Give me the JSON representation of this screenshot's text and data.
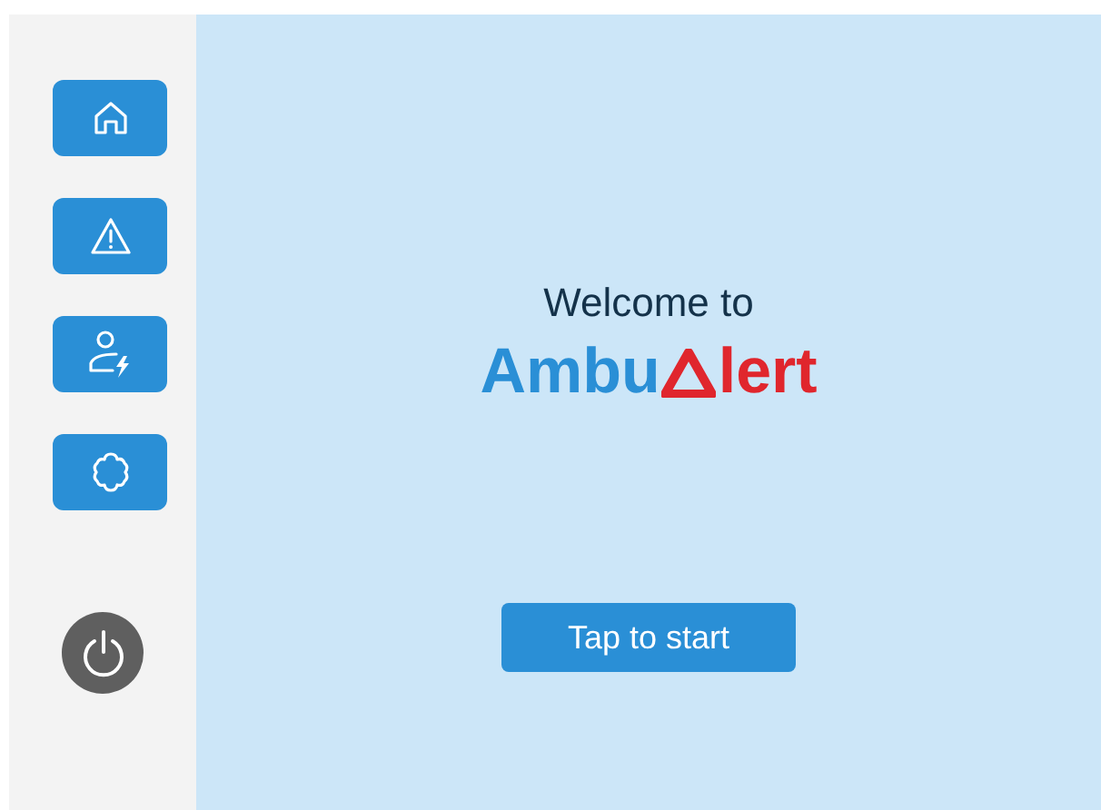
{
  "sidebar": {
    "items": [
      {
        "kind": "home"
      },
      {
        "kind": "alert"
      },
      {
        "kind": "driver"
      },
      {
        "kind": "settings"
      }
    ]
  },
  "welcome": {
    "heading": "Welcome to",
    "logo": {
      "part_1": "Ambu",
      "part_2": "lert"
    }
  },
  "start_button": "Tap to start"
}
